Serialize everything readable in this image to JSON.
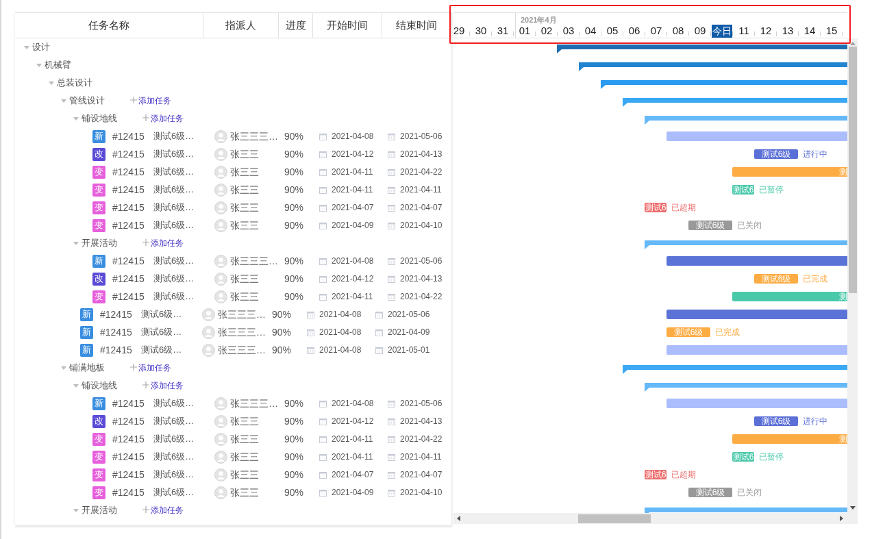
{
  "table": {
    "columns": [
      "任务名称",
      "指派人",
      "进度",
      "开始时间",
      "结束时间"
    ]
  },
  "timeline": {
    "month": "2021年4月",
    "days": [
      {
        "label": "29",
        "today": false
      },
      {
        "label": "30",
        "today": false
      },
      {
        "label": "31",
        "today": false
      },
      {
        "label": "01",
        "today": false
      },
      {
        "label": "02",
        "today": false
      },
      {
        "label": "03",
        "today": false
      },
      {
        "label": "04",
        "today": false
      },
      {
        "label": "05",
        "today": false
      },
      {
        "label": "06",
        "today": false
      },
      {
        "label": "07",
        "today": false
      },
      {
        "label": "08",
        "today": false
      },
      {
        "label": "09",
        "today": false
      },
      {
        "label": "今日",
        "today": true
      },
      {
        "label": "11",
        "today": false
      },
      {
        "label": "12",
        "today": false
      },
      {
        "label": "13",
        "today": false
      },
      {
        "label": "14",
        "today": false
      },
      {
        "label": "15",
        "today": false
      }
    ]
  },
  "tree": [
    {
      "name": "设计",
      "expanded": true,
      "color": "#1f6db1",
      "children": [
        {
          "name": "机械臂",
          "expanded": true,
          "color": "#2185d0",
          "children": [
            {
              "name": "总装设计",
              "expanded": true,
              "color": "#2b9bf0",
              "children": [
                {
                  "name": "管线设计",
                  "expanded": true,
                  "color": "#3aa8f5",
                  "add_link": "添加任务",
                  "children": [
                    {
                      "name": "铺设地线",
                      "expanded": true,
                      "color": "#66b9f8",
                      "add_link": "添加任务",
                      "children": [
                        {
                          "kind": "task",
                          "type": {
                            "label": "新",
                            "color": "#3a8ee0"
                          },
                          "id": "#12415",
                          "title": "测试6级…",
                          "assignee": "张三三三…",
                          "progress": "90%",
                          "start": "2021-04-08",
                          "end": "2021-05-06",
                          "gantt": {
                            "kind": "bar",
                            "color": "#abbdfd"
                          }
                        },
                        {
                          "kind": "task",
                          "type": {
                            "label": "改",
                            "color": "#5a4bd6"
                          },
                          "id": "#12415",
                          "title": "测试6级…",
                          "assignee": "张三三",
                          "progress": "90%",
                          "start": "2021-04-12",
                          "end": "2021-04-13",
                          "gantt": {
                            "kind": "badge",
                            "color": "#5b6fd6",
                            "label": "测试6级",
                            "status": "进行中"
                          }
                        },
                        {
                          "kind": "task",
                          "type": {
                            "label": "变",
                            "color": "#e660dc"
                          },
                          "id": "#12415",
                          "title": "测试6级…",
                          "assignee": "张三三",
                          "progress": "90%",
                          "start": "2021-04-11",
                          "end": "2021-04-22",
                          "gantt": {
                            "kind": "bar",
                            "color": "#fdac44",
                            "label": "测"
                          }
                        },
                        {
                          "kind": "task",
                          "type": {
                            "label": "变",
                            "color": "#e660dc"
                          },
                          "id": "#12415",
                          "title": "测试6级…",
                          "assignee": "张三三",
                          "progress": "90%",
                          "start": "2021-04-11",
                          "end": "2021-04-11",
                          "gantt": {
                            "kind": "badge",
                            "color": "#4ac9aa",
                            "label": "测试6",
                            "status": "已暂停"
                          }
                        },
                        {
                          "kind": "task",
                          "type": {
                            "label": "变",
                            "color": "#e660dc"
                          },
                          "id": "#12415",
                          "title": "测试6级…",
                          "assignee": "张三三",
                          "progress": "90%",
                          "start": "2021-04-07",
                          "end": "2021-04-07",
                          "gantt": {
                            "kind": "badge",
                            "color": "#ee6b6b",
                            "label": "测试6",
                            "status": "已超期"
                          }
                        },
                        {
                          "kind": "task",
                          "type": {
                            "label": "变",
                            "color": "#e660dc"
                          },
                          "id": "#12415",
                          "title": "测试6级…",
                          "assignee": "张三三",
                          "progress": "90%",
                          "start": "2021-04-09",
                          "end": "2021-04-10",
                          "gantt": {
                            "kind": "badge",
                            "color": "#999999",
                            "label": "测试6级",
                            "status": "已关闭"
                          }
                        }
                      ]
                    },
                    {
                      "name": "开展活动",
                      "expanded": true,
                      "color": "#66b9f8",
                      "add_link": "添加任务",
                      "children": [
                        {
                          "kind": "task",
                          "type": {
                            "label": "新",
                            "color": "#3a8ee0"
                          },
                          "id": "#12415",
                          "title": "测试6级…",
                          "assignee": "张三三三…",
                          "progress": "90%",
                          "start": "2021-04-08",
                          "end": "2021-05-06",
                          "gantt": {
                            "kind": "bar",
                            "color": "#5b73d6"
                          }
                        },
                        {
                          "kind": "task",
                          "type": {
                            "label": "改",
                            "color": "#5a4bd6"
                          },
                          "id": "#12415",
                          "title": "测试6级…",
                          "assignee": "张三三",
                          "progress": "90%",
                          "start": "2021-04-12",
                          "end": "2021-04-13",
                          "gantt": {
                            "kind": "badge",
                            "color": "#fdac44",
                            "label": "测试6级",
                            "status": "已完成"
                          }
                        },
                        {
                          "kind": "task",
                          "type": {
                            "label": "变",
                            "color": "#e660dc"
                          },
                          "id": "#12415",
                          "title": "测试6级…",
                          "assignee": "张三三",
                          "progress": "90%",
                          "start": "2021-04-11",
                          "end": "2021-04-22",
                          "gantt": {
                            "kind": "bar",
                            "color": "#4ac9aa",
                            "label": "测"
                          }
                        }
                      ]
                    },
                    {
                      "kind": "task",
                      "type": {
                        "label": "新",
                        "color": "#3a8ee0"
                      },
                      "id": "#12415",
                      "title": "测试6级…",
                      "assignee": "张三三三…",
                      "progress": "90%",
                      "start": "2021-04-08",
                      "end": "2021-05-06",
                      "gantt": {
                        "kind": "bar",
                        "color": "#5b73d6"
                      }
                    },
                    {
                      "kind": "task",
                      "type": {
                        "label": "新",
                        "color": "#3a8ee0"
                      },
                      "id": "#12415",
                      "title": "测试6级…",
                      "assignee": "张三三三…",
                      "progress": "90%",
                      "start": "2021-04-08",
                      "end": "2021-04-09",
                      "gantt": {
                        "kind": "badge",
                        "color": "#fdac44",
                        "label": "测试6级",
                        "status": "已完成"
                      }
                    },
                    {
                      "kind": "task",
                      "type": {
                        "label": "新",
                        "color": "#3a8ee0"
                      },
                      "id": "#12415",
                      "title": "测试6级…",
                      "assignee": "张三三三…",
                      "progress": "90%",
                      "start": "2021-04-08",
                      "end": "2021-05-01",
                      "gantt": {
                        "kind": "bar",
                        "color": "#abbdfd"
                      }
                    }
                  ]
                },
                {
                  "name": "铺满地板",
                  "expanded": true,
                  "color": "#3aa8f5",
                  "add_link": "添加任务",
                  "children": [
                    {
                      "name": "铺设地线",
                      "expanded": true,
                      "color": "#66b9f8",
                      "add_link": "添加任务",
                      "children": [
                        {
                          "kind": "task",
                          "type": {
                            "label": "新",
                            "color": "#3a8ee0"
                          },
                          "id": "#12415",
                          "title": "测试6级…",
                          "assignee": "张三三三…",
                          "progress": "90%",
                          "start": "2021-04-08",
                          "end": "2021-05-06",
                          "gantt": {
                            "kind": "bar",
                            "color": "#abbdfd"
                          }
                        },
                        {
                          "kind": "task",
                          "type": {
                            "label": "改",
                            "color": "#5a4bd6"
                          },
                          "id": "#12415",
                          "title": "测试6级…",
                          "assignee": "张三三",
                          "progress": "90%",
                          "start": "2021-04-12",
                          "end": "2021-04-13",
                          "gantt": {
                            "kind": "badge",
                            "color": "#5b6fd6",
                            "label": "测试6级",
                            "status": "进行中"
                          }
                        },
                        {
                          "kind": "task",
                          "type": {
                            "label": "变",
                            "color": "#e660dc"
                          },
                          "id": "#12415",
                          "title": "测试6级…",
                          "assignee": "张三三",
                          "progress": "90%",
                          "start": "2021-04-11",
                          "end": "2021-04-22",
                          "gantt": {
                            "kind": "bar",
                            "color": "#fdac44",
                            "label": "测"
                          }
                        },
                        {
                          "kind": "task",
                          "type": {
                            "label": "变",
                            "color": "#e660dc"
                          },
                          "id": "#12415",
                          "title": "测试6级…",
                          "assignee": "张三三",
                          "progress": "90%",
                          "start": "2021-04-11",
                          "end": "2021-04-11",
                          "gantt": {
                            "kind": "badge",
                            "color": "#4ac9aa",
                            "label": "测试6",
                            "status": "已暂停"
                          }
                        },
                        {
                          "kind": "task",
                          "type": {
                            "label": "变",
                            "color": "#e660dc"
                          },
                          "id": "#12415",
                          "title": "测试6级…",
                          "assignee": "张三三",
                          "progress": "90%",
                          "start": "2021-04-07",
                          "end": "2021-04-07",
                          "gantt": {
                            "kind": "badge",
                            "color": "#ee6b6b",
                            "label": "测试6",
                            "status": "已超期"
                          }
                        },
                        {
                          "kind": "task",
                          "type": {
                            "label": "变",
                            "color": "#e660dc"
                          },
                          "id": "#12415",
                          "title": "测试6级…",
                          "assignee": "张三三",
                          "progress": "90%",
                          "start": "2021-04-09",
                          "end": "2021-04-10",
                          "gantt": {
                            "kind": "badge",
                            "color": "#999999",
                            "label": "测试6级",
                            "status": "已关闭"
                          }
                        }
                      ]
                    },
                    {
                      "name": "开展活动",
                      "expanded": true,
                      "color": "#66b9f8",
                      "add_link": "添加任务"
                    }
                  ]
                }
              ]
            }
          ]
        }
      ]
    }
  ]
}
